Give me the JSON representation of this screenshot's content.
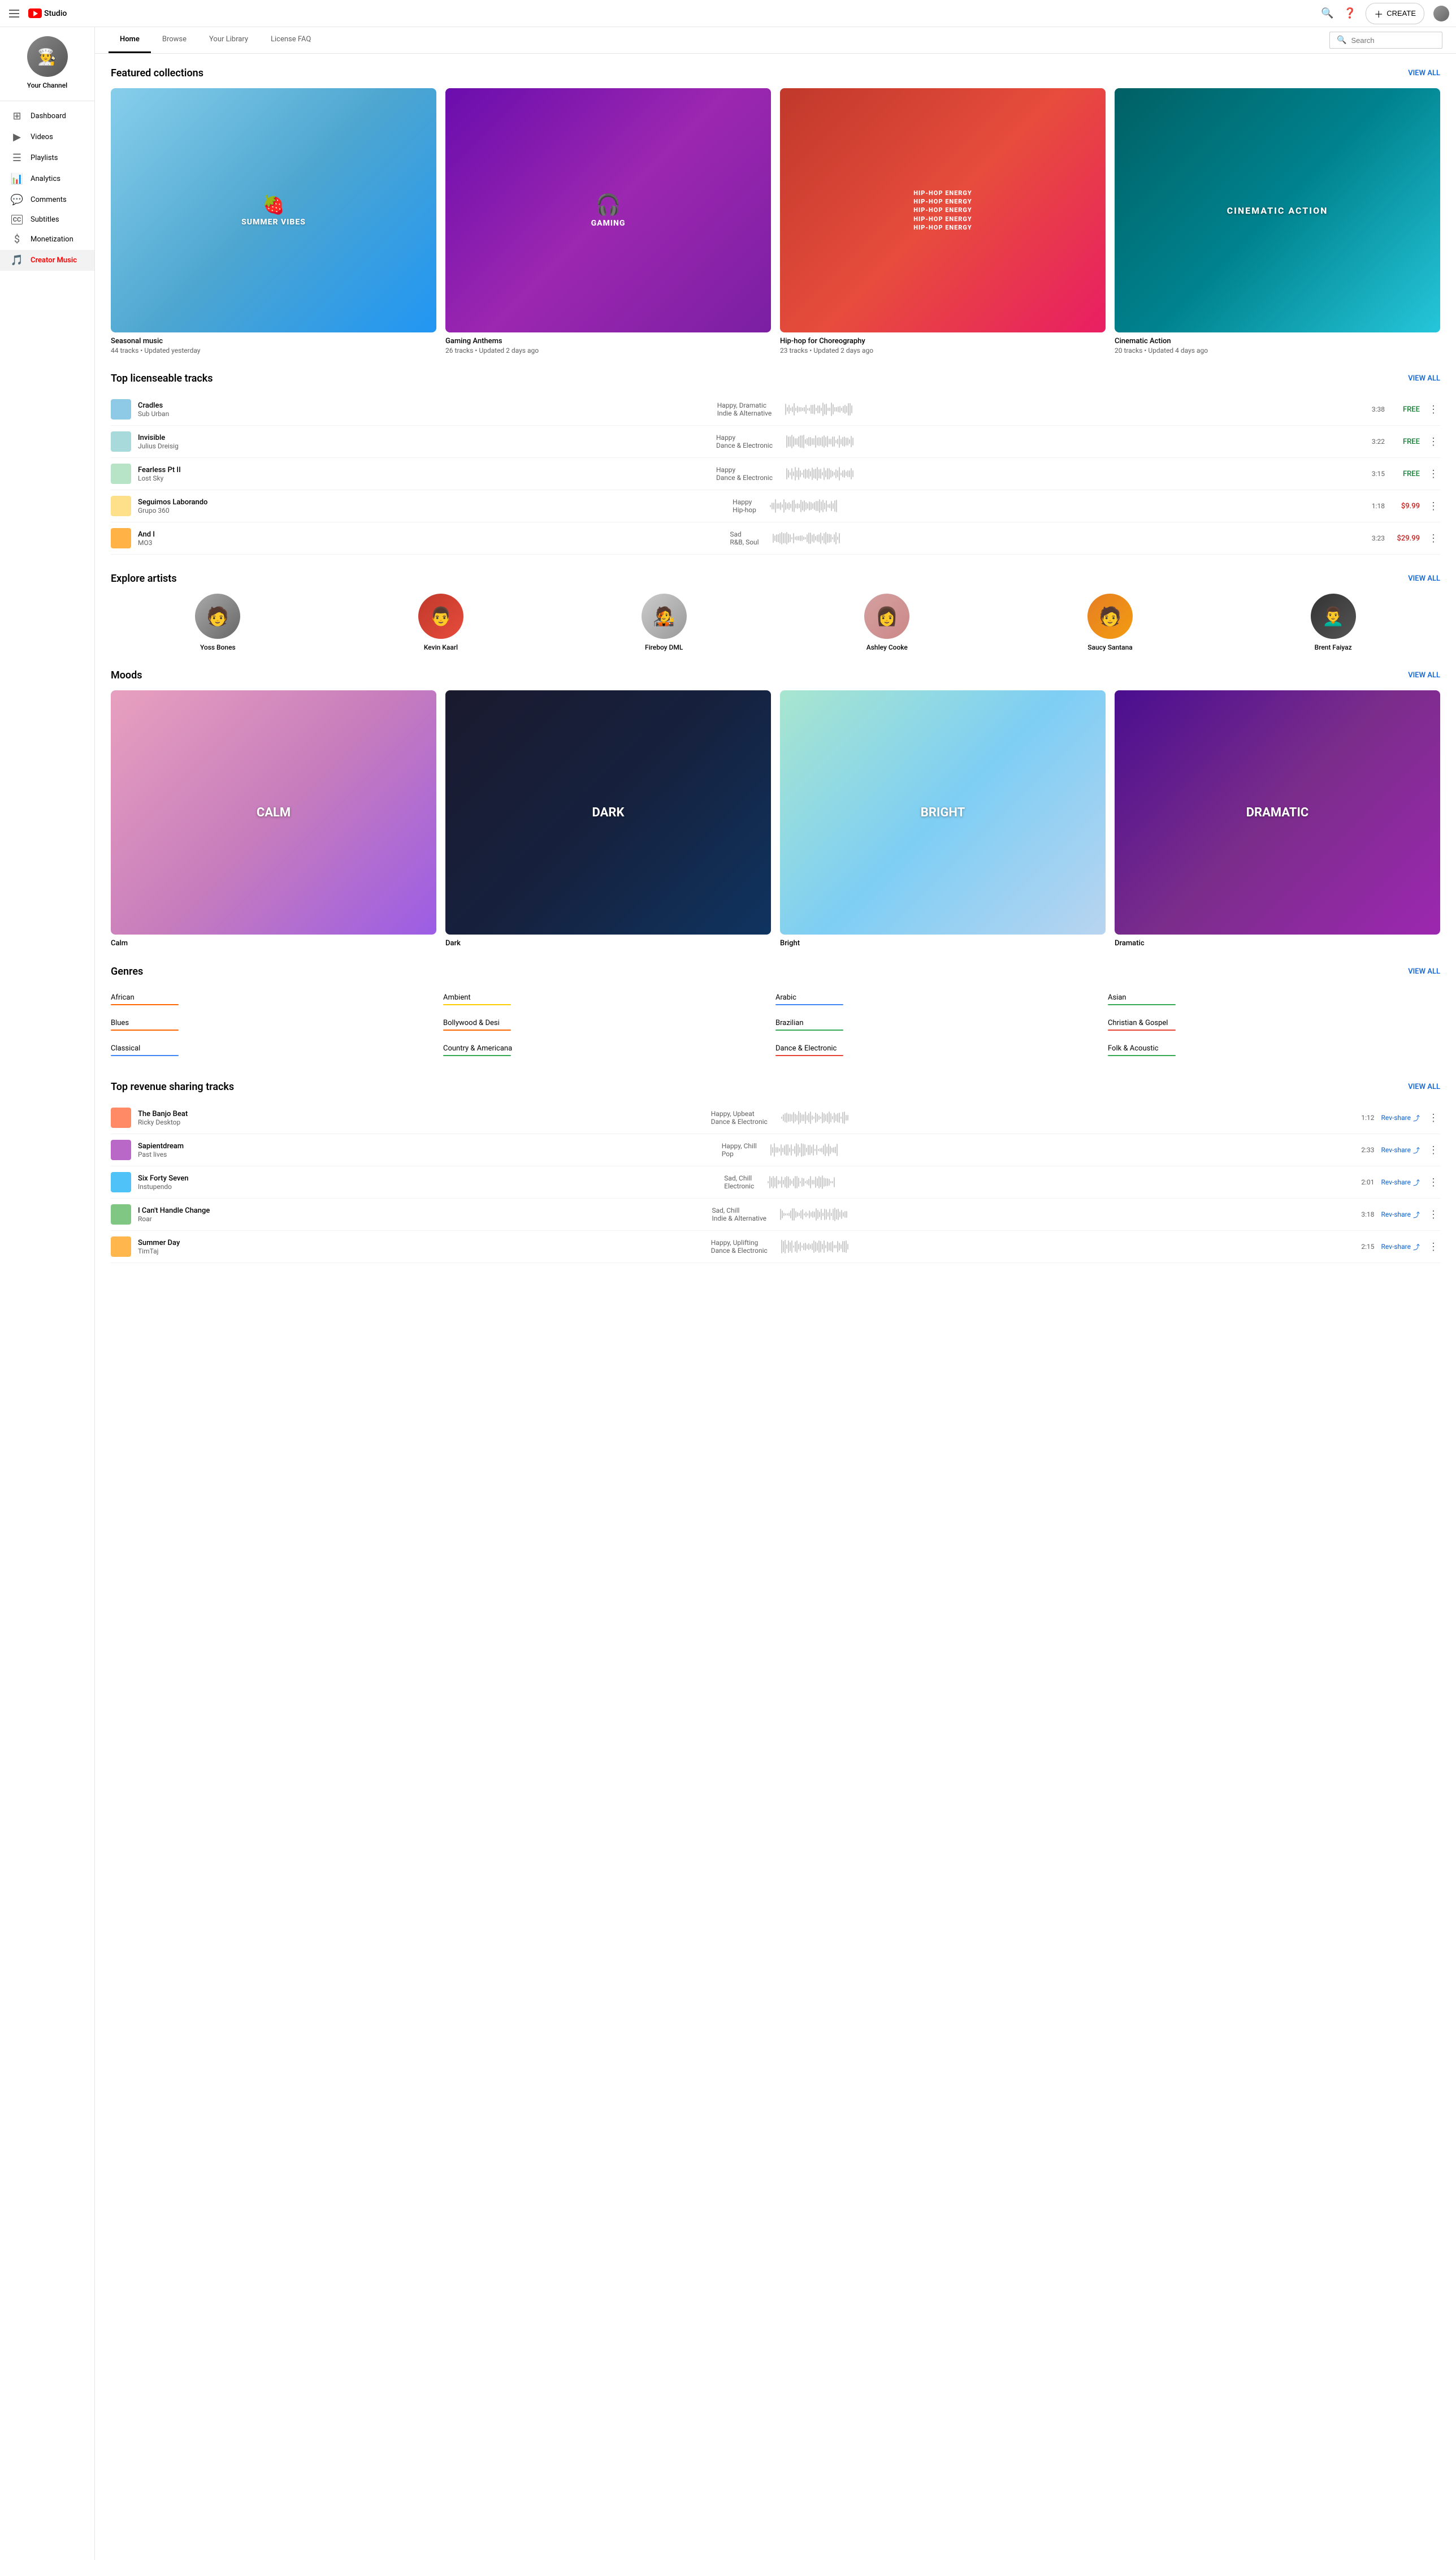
{
  "topNav": {
    "logoText": "Studio",
    "createLabel": "CREATE",
    "searchPlaceholder": "Search"
  },
  "sidebar": {
    "channelName": "Your Channel",
    "items": [
      {
        "id": "dashboard",
        "label": "Dashboard",
        "icon": "⊞"
      },
      {
        "id": "videos",
        "label": "Videos",
        "icon": "▶"
      },
      {
        "id": "playlists",
        "label": "Playlists",
        "icon": "☰"
      },
      {
        "id": "analytics",
        "label": "Analytics",
        "icon": "📊"
      },
      {
        "id": "comments",
        "label": "Comments",
        "icon": "💬"
      },
      {
        "id": "subtitles",
        "label": "Subtitles",
        "icon": "CC"
      },
      {
        "id": "monetization",
        "label": "Monetization",
        "icon": "$"
      },
      {
        "id": "creator-music",
        "label": "Creator Music",
        "icon": "🎵",
        "active": true
      }
    ]
  },
  "secondaryNav": {
    "items": [
      {
        "id": "home",
        "label": "Home",
        "active": true
      },
      {
        "id": "browse",
        "label": "Browse",
        "active": false
      },
      {
        "id": "library",
        "label": "Your Library",
        "active": false
      },
      {
        "id": "faq",
        "label": "License FAQ",
        "active": false
      }
    ]
  },
  "featuredCollections": {
    "title": "Featured collections",
    "viewAllLabel": "VIEW ALL",
    "items": [
      {
        "id": "summer",
        "name": "Seasonal music",
        "tracks": "44 tracks",
        "updated": "Updated yesterday",
        "label": "SUMMER VIBES",
        "theme": "summer"
      },
      {
        "id": "gaming",
        "name": "Gaming Anthems",
        "tracks": "26 tracks",
        "updated": "Updated 2 days ago",
        "label": "GAMING",
        "theme": "gaming"
      },
      {
        "id": "hiphop",
        "name": "Hip-hop for Choreography",
        "tracks": "23 tracks",
        "updated": "Updated 2 days ago",
        "label": "HIP-HOP ENERGY",
        "theme": "hiphop"
      },
      {
        "id": "cinematic",
        "name": "Cinematic Action",
        "tracks": "20 tracks",
        "updated": "Updated 4 days ago",
        "label": "CINEMATIC ACTION",
        "theme": "cinematic"
      }
    ]
  },
  "topLicenseable": {
    "title": "Top licenseable tracks",
    "viewAllLabel": "VIEW ALL",
    "tracks": [
      {
        "name": "Cradles",
        "artist": "Sub Urban",
        "mood": "Happy, Dramatic",
        "genre": "Indie & Alternative",
        "duration": "3:38",
        "price": "FREE",
        "priceType": "free"
      },
      {
        "name": "Invisible",
        "artist": "Julius Dreisig",
        "mood": "Happy",
        "genre": "Dance & Electronic",
        "duration": "3:22",
        "price": "FREE",
        "priceType": "free"
      },
      {
        "name": "Fearless Pt II",
        "artist": "Lost Sky",
        "mood": "Happy",
        "genre": "Dance & Electronic",
        "duration": "3:15",
        "price": "FREE",
        "priceType": "free"
      },
      {
        "name": "Seguimos Laborando",
        "artist": "Grupo 360",
        "mood": "Happy",
        "genre": "Hip-hop",
        "duration": "1:18",
        "price": "$9.99",
        "priceType": "paid"
      },
      {
        "name": "And I",
        "artist": "MO3",
        "mood": "Sad",
        "genre": "R&B, Soul",
        "duration": "3:23",
        "price": "$29.99",
        "priceType": "paid"
      }
    ]
  },
  "exploreArtists": {
    "title": "Explore artists",
    "viewAllLabel": "VIEW ALL",
    "artists": [
      {
        "name": "Yoss Bones",
        "avatarClass": "avatar-yoss"
      },
      {
        "name": "Kevin Kaarl",
        "avatarClass": "avatar-kevin"
      },
      {
        "name": "Fireboy DML",
        "avatarClass": "avatar-fireboy"
      },
      {
        "name": "Ashley Cooke",
        "avatarClass": "avatar-ashley"
      },
      {
        "name": "Saucy Santana",
        "avatarClass": "avatar-saucy"
      },
      {
        "name": "Brent Faiyaz",
        "avatarClass": "avatar-brent"
      }
    ]
  },
  "moods": {
    "title": "Moods",
    "viewAllLabel": "VIEW ALL",
    "items": [
      {
        "id": "calm",
        "label": "CALM",
        "name": "Calm",
        "theme": "calm"
      },
      {
        "id": "dark",
        "label": "DARK",
        "name": "Dark",
        "theme": "dark"
      },
      {
        "id": "bright",
        "label": "BRIGHT",
        "name": "Bright",
        "theme": "bright"
      },
      {
        "id": "dramatic",
        "label": "DRAMATIC",
        "name": "Dramatic",
        "theme": "dramatic"
      }
    ]
  },
  "genres": {
    "title": "Genres",
    "viewAllLabel": "VIEW ALL",
    "items": [
      {
        "label": "African",
        "color": "#ff6600"
      },
      {
        "label": "Ambient",
        "color": "#ffcc00"
      },
      {
        "label": "Arabic",
        "color": "#4285f4"
      },
      {
        "label": "Asian",
        "color": "#34a853"
      },
      {
        "label": "Blues",
        "color": "#ff6600"
      },
      {
        "label": "Bollywood & Desi",
        "color": "#ff6600"
      },
      {
        "label": "Brazilian",
        "color": "#34a853"
      },
      {
        "label": "Christian & Gospel",
        "color": "#ea4335"
      },
      {
        "label": "Classical",
        "color": "#4285f4"
      },
      {
        "label": "Country & Americana",
        "color": "#34a853"
      },
      {
        "label": "Dance & Electronic",
        "color": "#ea4335"
      },
      {
        "label": "Folk & Acoustic",
        "color": "#34a853"
      }
    ]
  },
  "topRevenueSharing": {
    "title": "Top revenue sharing tracks",
    "viewAllLabel": "VIEW ALL",
    "tracks": [
      {
        "name": "The Banjo Beat",
        "artist": "Ricky Desktop",
        "mood": "Happy, Upbeat",
        "genre": "Dance & Electronic",
        "duration": "1:12"
      },
      {
        "name": "Sapientdream",
        "artist": "Past lives",
        "mood": "Happy, Chill",
        "genre": "Pop",
        "duration": "2:33"
      },
      {
        "name": "Six Forty Seven",
        "artist": "Instupendo",
        "mood": "Sad, Chill",
        "genre": "Electronic",
        "duration": "2:01"
      },
      {
        "name": "I Can't Handle Change",
        "artist": "Roar",
        "mood": "Sad, Chill",
        "genre": "Indie & Alternative",
        "duration": "3:18"
      },
      {
        "name": "Summer Day",
        "artist": "TimTaj",
        "mood": "Happy, Uplifting",
        "genre": "Dance & Electronic",
        "duration": "2:15"
      }
    ],
    "revShareLabel": "Rev-share"
  }
}
